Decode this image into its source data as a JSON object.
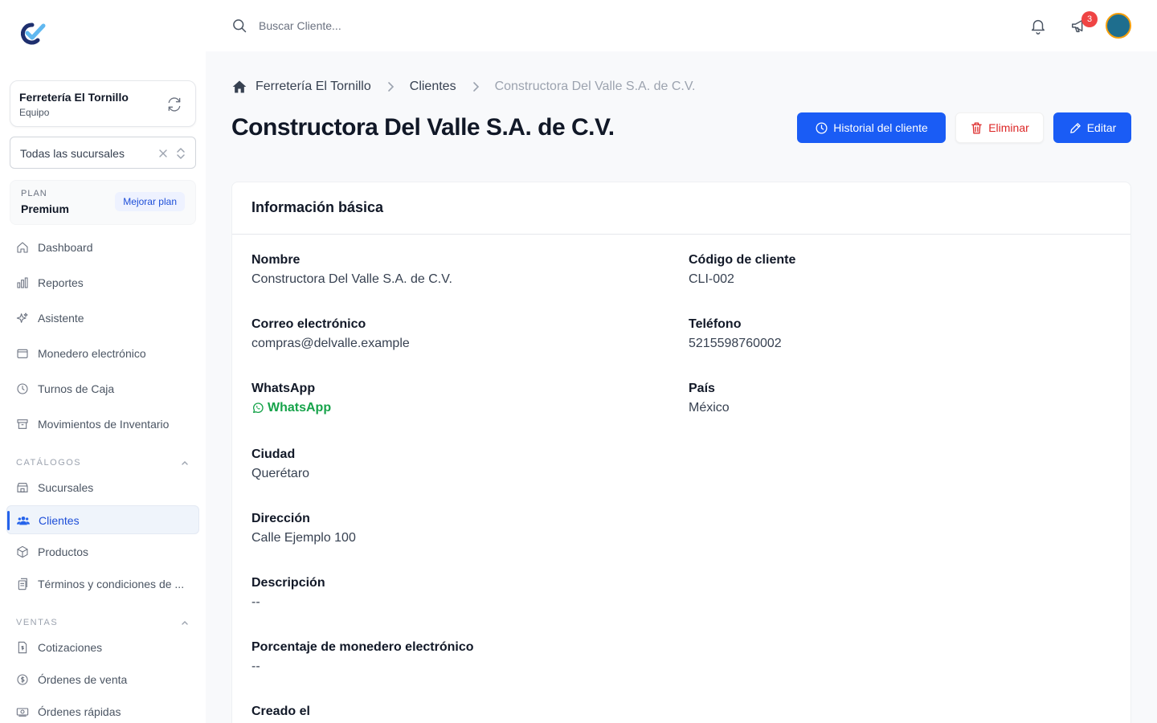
{
  "team": {
    "name": "Ferretería El Tornillo",
    "role": "Equipo"
  },
  "branch_select": {
    "value": "Todas las sucursales"
  },
  "plan": {
    "label": "PLAN",
    "name": "Premium",
    "upgrade_label": "Mejorar plan"
  },
  "nav": {
    "main": [
      {
        "label": "Dashboard",
        "icon": "home-icon"
      },
      {
        "label": "Reportes",
        "icon": "chart-bar-icon"
      },
      {
        "label": "Asistente",
        "icon": "sparkles-icon"
      },
      {
        "label": "Monedero electrónico",
        "icon": "wallet-icon"
      },
      {
        "label": "Turnos de Caja",
        "icon": "clock-icon"
      },
      {
        "label": "Movimientos de Inventario",
        "icon": "archive-icon"
      }
    ],
    "catalogos_title": "CATÁLOGOS",
    "catalogos": [
      {
        "label": "Sucursales",
        "icon": "store-icon"
      },
      {
        "label": "Clientes",
        "icon": "users-icon",
        "active": true
      },
      {
        "label": "Productos",
        "icon": "cube-icon"
      },
      {
        "label": "Términos y condiciones de ...",
        "icon": "document-icon"
      }
    ],
    "ventas_title": "VENTAS",
    "ventas": [
      {
        "label": "Cotizaciones",
        "icon": "document-dollar-icon"
      },
      {
        "label": "Órdenes de venta",
        "icon": "currency-circle-icon"
      },
      {
        "label": "Órdenes rápidas",
        "icon": "banknote-icon"
      }
    ]
  },
  "search": {
    "placeholder": "Buscar Cliente..."
  },
  "notifications": {
    "count": "3"
  },
  "breadcrumb": {
    "home": "Ferretería El Tornillo",
    "section": "Clientes",
    "current": "Constructora Del Valle S.A. de C.V."
  },
  "page_title": "Constructora Del Valle S.A. de C.V.",
  "actions": {
    "history": "Historial del cliente",
    "delete": "Eliminar",
    "edit": "Editar"
  },
  "card": {
    "title": "Información básica",
    "fields": {
      "nombre": {
        "label": "Nombre",
        "value": "Constructora Del Valle S.A. de C.V."
      },
      "codigo": {
        "label": "Código de cliente",
        "value": "CLI-002"
      },
      "correo": {
        "label": "Correo electrónico",
        "value": "compras@delvalle.example"
      },
      "telefono": {
        "label": "Teléfono",
        "value": "5215598760002"
      },
      "whatsapp": {
        "label": "WhatsApp",
        "value": "WhatsApp"
      },
      "pais": {
        "label": "País",
        "value": "México"
      },
      "ciudad": {
        "label": "Ciudad",
        "value": "Querétaro"
      },
      "direccion": {
        "label": "Dirección",
        "value": "Calle Ejemplo 100"
      },
      "descripcion": {
        "label": "Descripción",
        "value": "--"
      },
      "porcentaje": {
        "label": "Porcentaje de monedero electrónico",
        "value": "--"
      },
      "creado": {
        "label": "Creado el",
        "value": ""
      }
    }
  },
  "colors": {
    "primary": "#1a5cf5",
    "danger": "#dc2626",
    "whatsapp": "#16a34a",
    "badge": "#ef4444"
  }
}
